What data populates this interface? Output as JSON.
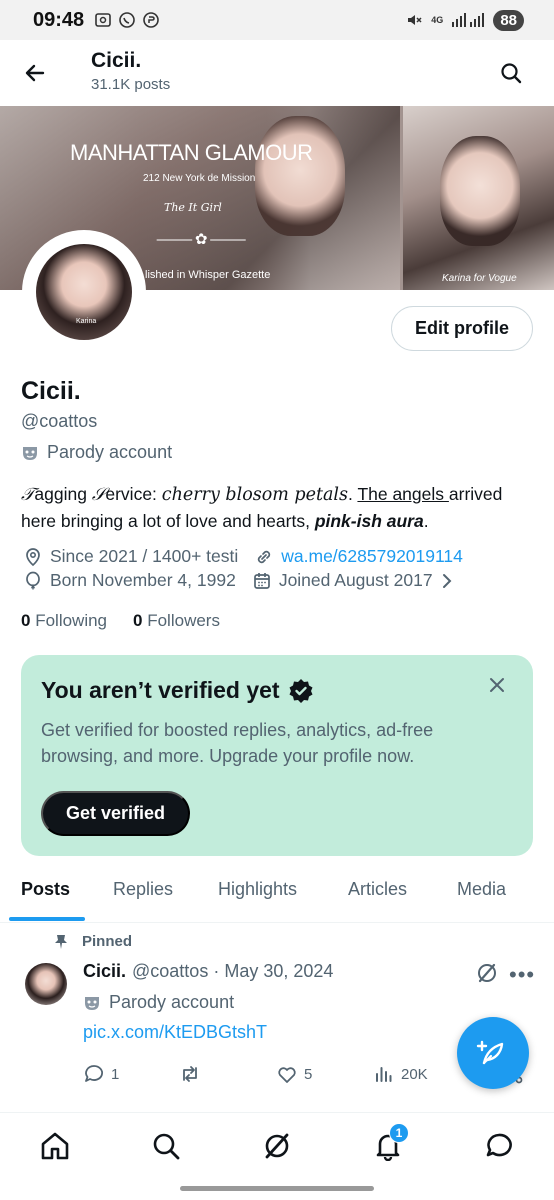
{
  "status_bar": {
    "time": "09:48",
    "network": "4G",
    "battery": "88"
  },
  "header": {
    "title": "Cicii.",
    "posts_count": "31.1K posts"
  },
  "banner": {
    "title": "MANHATTAN GLAMOUR",
    "subtitle": "212 New York de Mission",
    "script": "The It Girl",
    "ornament": "⸻✿⸻",
    "published": "lished in Whisper Gazette",
    "credit": "Karina for Vogue"
  },
  "avatar": {
    "tag": "Karina"
  },
  "profile": {
    "edit_label": "Edit profile",
    "name": "Cicii.",
    "handle": "@coattos",
    "parody_label": "Parody account",
    "bio": {
      "p1": "𝒯",
      "p2": "agging ",
      "p3": "𝒮",
      "p4": "ervice: ",
      "p5": "cherry blosom petals",
      "p6": ".  ",
      "p7": "The angels ",
      "p8": "arrived here bringing a lot of love and hearts, ",
      "p9": "pink-ish aura",
      "p10": "."
    },
    "location": "Since 2021 / 1400+ testi",
    "website": "wa.me/6285792019114",
    "birthday": "Born November 4, 1992",
    "joined": "Joined August 2017",
    "following_count": "0",
    "following_label": "Following",
    "followers_count": "0",
    "followers_label": "Followers"
  },
  "verify_card": {
    "title": "You aren’t verified yet",
    "text": "Get verified for boosted replies, analytics, ad-free browsing, and more. Upgrade your profile now.",
    "button": "Get verified"
  },
  "tabs": [
    "Posts",
    "Replies",
    "Highlights",
    "Articles",
    "Media"
  ],
  "post": {
    "pinned_label": "Pinned",
    "author": "Cicii.",
    "meta": "@coattos · May 30, 2024",
    "parody_label": "Parody account",
    "link": "pic.x.com/KtEDBGtshT",
    "replies": "1",
    "likes": "5",
    "views": "20K"
  },
  "bottom_nav": {
    "notifications_badge": "1"
  },
  "colors": {
    "accent": "#1d9bf0",
    "card_bg": "#c2ecdb",
    "text": "#0f1419",
    "muted": "#536471"
  }
}
